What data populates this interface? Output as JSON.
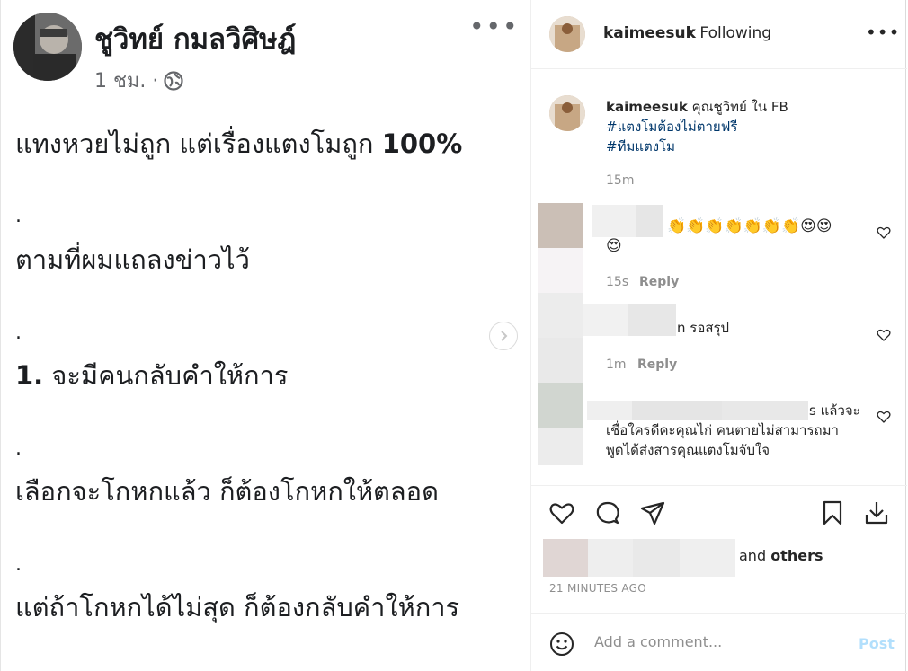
{
  "fb_post": {
    "author": "ชูวิทย์ กมลวิศิษฎ์",
    "time": "1 ชม. ·",
    "lines": [
      {
        "text": "แทงหวยไม่ถูก แต่เรื่องแตงโมถูก ",
        "bold": "100%"
      },
      {
        "dot": "."
      },
      {
        "text": "ตามที่ผมแถลงข่าวไว้"
      },
      {
        "dot": "."
      },
      {
        "bold_prefix": "1.",
        "text": " จะมีคนกลับคำให้การ"
      },
      {
        "dot": "."
      },
      {
        "text": "เลือกจะโกหกแล้ว ก็ต้องโกหกให้ตลอด"
      },
      {
        "dot": "."
      },
      {
        "text": "แต่ถ้าโกหกได้ไม่สุด ก็ต้องกลับคำให้การ"
      }
    ]
  },
  "header": {
    "username": "kaimeesuk",
    "follow_status": "• Following"
  },
  "caption": {
    "username": "kaimeesuk",
    "text": " คุณชูวิทย์ ใน FB",
    "hashtags": [
      "#แตงโมต้องไม่ตายฟรี",
      "#ทีมแตงโม"
    ],
    "time": "15m"
  },
  "comments": [
    {
      "emoji": "👏👏👏👏👏👏👏😍😍",
      "emoji2": "😍",
      "time": "15s",
      "reply": "Reply"
    },
    {
      "text": "n รอสรุป",
      "time": "1m",
      "reply": "Reply"
    },
    {
      "text_line1": "s แล้วจะ",
      "text_line2": "เชื่อใครดีคะคุณไก่ คนตายไม่สามารถมา",
      "text_line3": "พูดได้ส่งสารคุณแตงโมจับใจ"
    }
  ],
  "likes": {
    "suffix": "and ",
    "others": "others",
    "ago": "21 MINUTES AGO"
  },
  "add_comment": {
    "placeholder": "Add a comment...",
    "post_label": "Post"
  },
  "colors": {
    "link": "#00376b",
    "muted": "#8e8e8e",
    "post_disabled": "#b2dffc"
  },
  "icons": [
    "globe-icon",
    "chevron-right-icon",
    "more-icon",
    "heart-icon",
    "comment-icon",
    "share-icon",
    "bookmark-icon",
    "download-icon",
    "emoji-icon"
  ]
}
